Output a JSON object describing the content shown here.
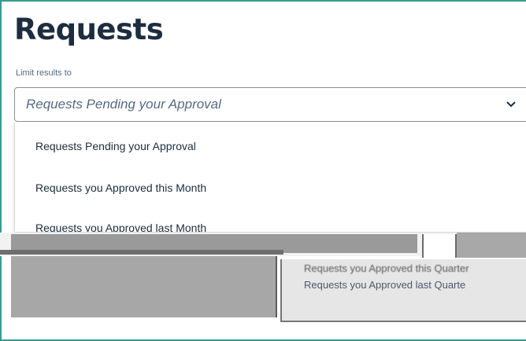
{
  "page": {
    "title": "Requests",
    "limit_label": "Limit results to"
  },
  "filter": {
    "selected_value": "Requests Pending your Approval",
    "chevron_icon": "chevron-down-icon"
  },
  "dropdown": {
    "options": [
      {
        "label": "Requests Pending your Approval"
      },
      {
        "label": "Requests you Approved this Month"
      },
      {
        "label": "Requests you Approved last Month"
      }
    ]
  },
  "artifact": {
    "partial_text_1": "Requests you Approved this Quarter",
    "partial_text_2": "Requests you Approved last Quarte"
  },
  "colors": {
    "frame_border": "#3a9a8f",
    "title": "#1d2d3e",
    "muted_text": "#556b82"
  }
}
